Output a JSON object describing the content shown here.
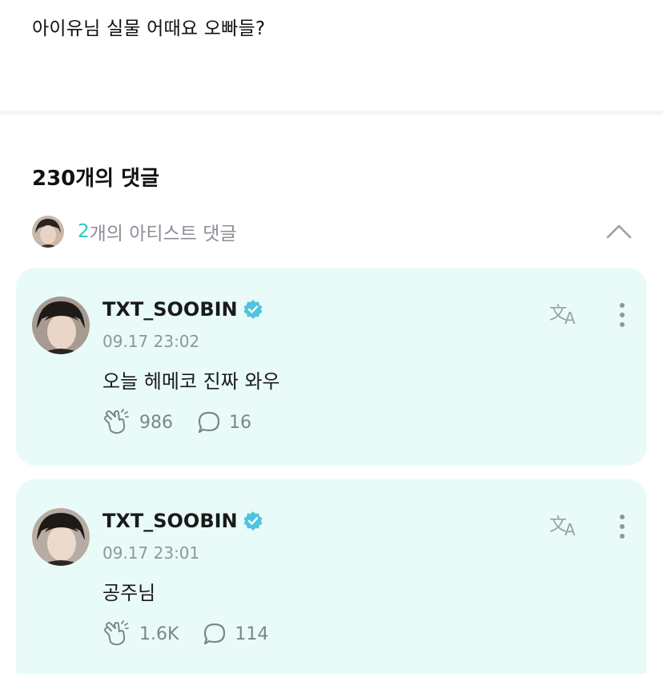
{
  "post": {
    "text": "아이유님 실물 어때요 오빠들?"
  },
  "comments_header": {
    "title": "230개의 댓글",
    "artist_count": "2",
    "artist_label": "개의 아티스트 댓글"
  },
  "comments": [
    {
      "username": "TXT_SOOBIN",
      "time": "09.17 23:02",
      "text": "오늘 헤메코 진짜 와우",
      "likes": "986",
      "replies": "16"
    },
    {
      "username": "TXT_SOOBIN",
      "time": "09.17 23:01",
      "text": "공주님",
      "likes": "1.6K",
      "replies": "114"
    }
  ],
  "icons": {
    "verified": "verified-badge-icon",
    "translate": "translate-icon",
    "more": "more-vertical-icon",
    "like": "hand-clap-like-icon",
    "reply": "speech-bubble-icon",
    "collapse": "chevron-up-icon"
  },
  "colors": {
    "accent": "#26c6cf",
    "card_bg": "#e9fbf8",
    "verified": "#4fc3e0"
  }
}
